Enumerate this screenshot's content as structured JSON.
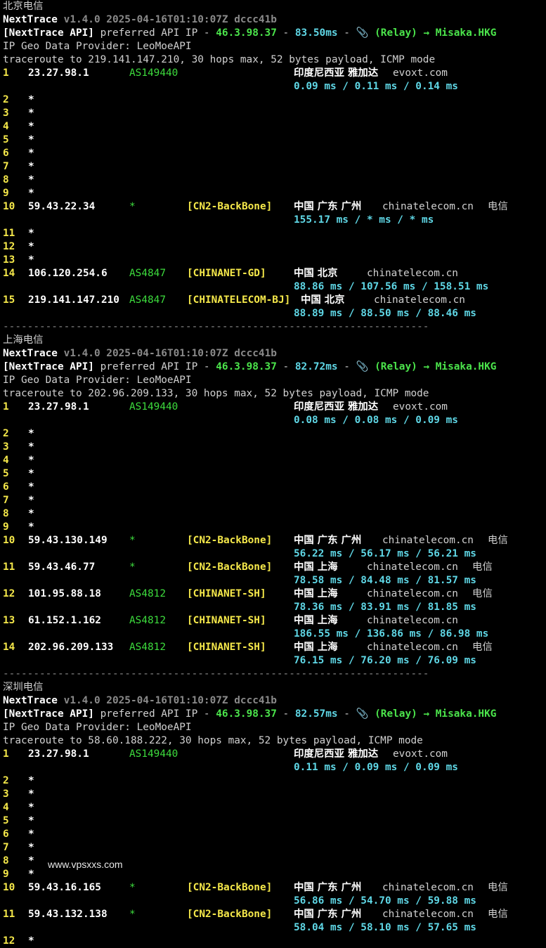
{
  "version_meta": "v1.4.0 2025-04-16T01:10:07Z dccc41b",
  "app_name": "NextTrace",
  "api_label": "[NextTrace API]",
  "api_text": " preferred API IP - ",
  "api_ip": "46.3.98.37",
  "dash": " - ",
  "relay": "📎 (Relay) → Misaka.HKG",
  "geo_provider": "IP Geo Data Provider: LeoMoeAPI",
  "separator": "----------------------------------------------------------------------",
  "watermark": "www.vpsxxs.com",
  "sections": [
    {
      "title": "北京电信",
      "latency": "83.50ms",
      "traceroute": "traceroute to 219.141.147.210, 30 hops max, 52 bytes payload, ICMP mode",
      "hops": [
        {
          "hop": "1",
          "ip": "23.27.98.1",
          "asn": "AS149440",
          "tag": "",
          "geo": "印度尼西亚 雅加达",
          "domain": "evoxt.com",
          "isp": "",
          "rtt": "0.09 ms / 0.11 ms / 0.14 ms"
        },
        {
          "hop": "2",
          "ip": "*"
        },
        {
          "hop": "3",
          "ip": "*"
        },
        {
          "hop": "4",
          "ip": "*"
        },
        {
          "hop": "5",
          "ip": "*"
        },
        {
          "hop": "6",
          "ip": "*"
        },
        {
          "hop": "7",
          "ip": "*"
        },
        {
          "hop": "8",
          "ip": "*"
        },
        {
          "hop": "9",
          "ip": "*"
        },
        {
          "hop": "10",
          "ip": "59.43.22.34",
          "asn": "*",
          "tag": "[CN2-BackBone]",
          "geo": "中国 广东 广州",
          "domain": "chinatelecom.cn",
          "isp": "电信",
          "rtt": "155.17 ms / * ms / * ms"
        },
        {
          "hop": "11",
          "ip": "*"
        },
        {
          "hop": "12",
          "ip": "*"
        },
        {
          "hop": "13",
          "ip": "*"
        },
        {
          "hop": "14",
          "ip": "106.120.254.6",
          "asn": "AS4847",
          "tag": "[CHINANET-GD]",
          "geo": "中国 北京",
          "domain": "chinatelecom.cn",
          "isp": "",
          "rtt": "88.86 ms / 107.56 ms / 158.51 ms"
        },
        {
          "hop": "15",
          "ip": "219.141.147.210",
          "asn": "AS4847",
          "tag": "[CHINATELECOM-BJ]",
          "geo": "中国 北京",
          "domain": "chinatelecom.cn",
          "isp": "",
          "rtt": "88.89 ms / 88.50 ms / 88.46 ms"
        }
      ]
    },
    {
      "title": "上海电信",
      "latency": "82.72ms",
      "traceroute": "traceroute to 202.96.209.133, 30 hops max, 52 bytes payload, ICMP mode",
      "hops": [
        {
          "hop": "1",
          "ip": "23.27.98.1",
          "asn": "AS149440",
          "tag": "",
          "geo": "印度尼西亚 雅加达",
          "domain": "evoxt.com",
          "isp": "",
          "rtt": "0.08 ms / 0.08 ms / 0.09 ms"
        },
        {
          "hop": "2",
          "ip": "*"
        },
        {
          "hop": "3",
          "ip": "*"
        },
        {
          "hop": "4",
          "ip": "*"
        },
        {
          "hop": "5",
          "ip": "*"
        },
        {
          "hop": "6",
          "ip": "*"
        },
        {
          "hop": "7",
          "ip": "*"
        },
        {
          "hop": "8",
          "ip": "*"
        },
        {
          "hop": "9",
          "ip": "*"
        },
        {
          "hop": "10",
          "ip": "59.43.130.149",
          "asn": "*",
          "tag": "[CN2-BackBone]",
          "geo": "中国 广东 广州",
          "domain": "chinatelecom.cn",
          "isp": "电信",
          "rtt": "56.22 ms / 56.17 ms / 56.21 ms"
        },
        {
          "hop": "11",
          "ip": "59.43.46.77",
          "asn": "*",
          "tag": "[CN2-BackBone]",
          "geo": "中国 上海",
          "domain": "chinatelecom.cn",
          "isp": "电信",
          "rtt": "78.58 ms / 84.48 ms / 81.57 ms"
        },
        {
          "hop": "12",
          "ip": "101.95.88.18",
          "asn": "AS4812",
          "tag": "[CHINANET-SH]",
          "geo": "中国 上海",
          "domain": "chinatelecom.cn",
          "isp": "电信",
          "rtt": "78.36 ms / 83.91 ms / 81.85 ms"
        },
        {
          "hop": "13",
          "ip": "61.152.1.162",
          "asn": "AS4812",
          "tag": "[CHINANET-SH]",
          "geo": "中国 上海",
          "domain": "chinatelecom.cn",
          "isp": "",
          "rtt": "186.55 ms / 136.86 ms / 86.98 ms"
        },
        {
          "hop": "14",
          "ip": "202.96.209.133",
          "asn": "AS4812",
          "tag": "[CHINANET-SH]",
          "geo": "中国 上海",
          "domain": "chinatelecom.cn",
          "isp": "电信",
          "rtt": "76.15 ms / 76.20 ms / 76.09 ms"
        }
      ]
    },
    {
      "title": "深圳电信",
      "latency": "82.57ms",
      "traceroute": "traceroute to 58.60.188.222, 30 hops max, 52 bytes payload, ICMP mode",
      "hops": [
        {
          "hop": "1",
          "ip": "23.27.98.1",
          "asn": "AS149440",
          "tag": "",
          "geo": "印度尼西亚 雅加达",
          "domain": "evoxt.com",
          "isp": "",
          "rtt": "0.11 ms / 0.09 ms / 0.09 ms"
        },
        {
          "hop": "2",
          "ip": "*"
        },
        {
          "hop": "3",
          "ip": "*"
        },
        {
          "hop": "4",
          "ip": "*"
        },
        {
          "hop": "5",
          "ip": "*"
        },
        {
          "hop": "6",
          "ip": "*"
        },
        {
          "hop": "7",
          "ip": "*"
        },
        {
          "hop": "8",
          "ip": "*"
        },
        {
          "hop": "9",
          "ip": "*"
        },
        {
          "hop": "10",
          "ip": "59.43.16.165",
          "asn": "*",
          "tag": "[CN2-BackBone]",
          "geo": "中国 广东 广州",
          "domain": "chinatelecom.cn",
          "isp": "电信",
          "rtt": "56.86 ms / 54.70 ms / 59.88 ms"
        },
        {
          "hop": "11",
          "ip": "59.43.132.138",
          "asn": "*",
          "tag": "[CN2-BackBone]",
          "geo": "中国 广东 广州",
          "domain": "chinatelecom.cn",
          "isp": "电信",
          "rtt": "58.04 ms / 58.10 ms / 57.65 ms"
        },
        {
          "hop": "12",
          "ip": "*"
        }
      ]
    }
  ]
}
